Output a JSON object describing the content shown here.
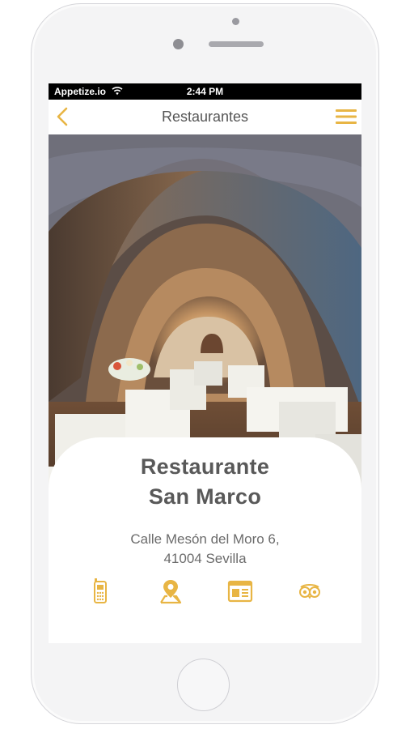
{
  "status_bar": {
    "carrier": "Appetize.io",
    "time": "2:44 PM"
  },
  "nav": {
    "title": "Restaurantes"
  },
  "restaurant": {
    "name_line1": "Restaurante",
    "name_line2": "San Marco",
    "address_line1": "Calle Mesón del Moro 6,",
    "address_line2": "41004 Sevilla"
  },
  "actions": [
    {
      "icon": "phone-icon"
    },
    {
      "icon": "map-pin-icon"
    },
    {
      "icon": "menu-card-icon"
    },
    {
      "icon": "tripadvisor-icon"
    }
  ],
  "colors": {
    "accent": "#e8b544",
    "title_text": "#595959",
    "body_text": "#6b6b6b"
  }
}
